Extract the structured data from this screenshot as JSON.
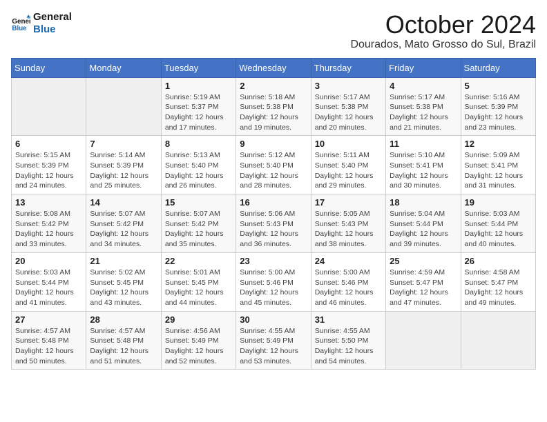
{
  "header": {
    "logo_general": "General",
    "logo_blue": "Blue",
    "month_title": "October 2024",
    "location": "Dourados, Mato Grosso do Sul, Brazil"
  },
  "calendar": {
    "days_of_week": [
      "Sunday",
      "Monday",
      "Tuesday",
      "Wednesday",
      "Thursday",
      "Friday",
      "Saturday"
    ],
    "weeks": [
      [
        {
          "day": "",
          "info": ""
        },
        {
          "day": "",
          "info": ""
        },
        {
          "day": "1",
          "info": "Sunrise: 5:19 AM\nSunset: 5:37 PM\nDaylight: 12 hours and 17 minutes."
        },
        {
          "day": "2",
          "info": "Sunrise: 5:18 AM\nSunset: 5:38 PM\nDaylight: 12 hours and 19 minutes."
        },
        {
          "day": "3",
          "info": "Sunrise: 5:17 AM\nSunset: 5:38 PM\nDaylight: 12 hours and 20 minutes."
        },
        {
          "day": "4",
          "info": "Sunrise: 5:17 AM\nSunset: 5:38 PM\nDaylight: 12 hours and 21 minutes."
        },
        {
          "day": "5",
          "info": "Sunrise: 5:16 AM\nSunset: 5:39 PM\nDaylight: 12 hours and 23 minutes."
        }
      ],
      [
        {
          "day": "6",
          "info": "Sunrise: 5:15 AM\nSunset: 5:39 PM\nDaylight: 12 hours and 24 minutes."
        },
        {
          "day": "7",
          "info": "Sunrise: 5:14 AM\nSunset: 5:39 PM\nDaylight: 12 hours and 25 minutes."
        },
        {
          "day": "8",
          "info": "Sunrise: 5:13 AM\nSunset: 5:40 PM\nDaylight: 12 hours and 26 minutes."
        },
        {
          "day": "9",
          "info": "Sunrise: 5:12 AM\nSunset: 5:40 PM\nDaylight: 12 hours and 28 minutes."
        },
        {
          "day": "10",
          "info": "Sunrise: 5:11 AM\nSunset: 5:40 PM\nDaylight: 12 hours and 29 minutes."
        },
        {
          "day": "11",
          "info": "Sunrise: 5:10 AM\nSunset: 5:41 PM\nDaylight: 12 hours and 30 minutes."
        },
        {
          "day": "12",
          "info": "Sunrise: 5:09 AM\nSunset: 5:41 PM\nDaylight: 12 hours and 31 minutes."
        }
      ],
      [
        {
          "day": "13",
          "info": "Sunrise: 5:08 AM\nSunset: 5:42 PM\nDaylight: 12 hours and 33 minutes."
        },
        {
          "day": "14",
          "info": "Sunrise: 5:07 AM\nSunset: 5:42 PM\nDaylight: 12 hours and 34 minutes."
        },
        {
          "day": "15",
          "info": "Sunrise: 5:07 AM\nSunset: 5:42 PM\nDaylight: 12 hours and 35 minutes."
        },
        {
          "day": "16",
          "info": "Sunrise: 5:06 AM\nSunset: 5:43 PM\nDaylight: 12 hours and 36 minutes."
        },
        {
          "day": "17",
          "info": "Sunrise: 5:05 AM\nSunset: 5:43 PM\nDaylight: 12 hours and 38 minutes."
        },
        {
          "day": "18",
          "info": "Sunrise: 5:04 AM\nSunset: 5:44 PM\nDaylight: 12 hours and 39 minutes."
        },
        {
          "day": "19",
          "info": "Sunrise: 5:03 AM\nSunset: 5:44 PM\nDaylight: 12 hours and 40 minutes."
        }
      ],
      [
        {
          "day": "20",
          "info": "Sunrise: 5:03 AM\nSunset: 5:44 PM\nDaylight: 12 hours and 41 minutes."
        },
        {
          "day": "21",
          "info": "Sunrise: 5:02 AM\nSunset: 5:45 PM\nDaylight: 12 hours and 43 minutes."
        },
        {
          "day": "22",
          "info": "Sunrise: 5:01 AM\nSunset: 5:45 PM\nDaylight: 12 hours and 44 minutes."
        },
        {
          "day": "23",
          "info": "Sunrise: 5:00 AM\nSunset: 5:46 PM\nDaylight: 12 hours and 45 minutes."
        },
        {
          "day": "24",
          "info": "Sunrise: 5:00 AM\nSunset: 5:46 PM\nDaylight: 12 hours and 46 minutes."
        },
        {
          "day": "25",
          "info": "Sunrise: 4:59 AM\nSunset: 5:47 PM\nDaylight: 12 hours and 47 minutes."
        },
        {
          "day": "26",
          "info": "Sunrise: 4:58 AM\nSunset: 5:47 PM\nDaylight: 12 hours and 49 minutes."
        }
      ],
      [
        {
          "day": "27",
          "info": "Sunrise: 4:57 AM\nSunset: 5:48 PM\nDaylight: 12 hours and 50 minutes."
        },
        {
          "day": "28",
          "info": "Sunrise: 4:57 AM\nSunset: 5:48 PM\nDaylight: 12 hours and 51 minutes."
        },
        {
          "day": "29",
          "info": "Sunrise: 4:56 AM\nSunset: 5:49 PM\nDaylight: 12 hours and 52 minutes."
        },
        {
          "day": "30",
          "info": "Sunrise: 4:55 AM\nSunset: 5:49 PM\nDaylight: 12 hours and 53 minutes."
        },
        {
          "day": "31",
          "info": "Sunrise: 4:55 AM\nSunset: 5:50 PM\nDaylight: 12 hours and 54 minutes."
        },
        {
          "day": "",
          "info": ""
        },
        {
          "day": "",
          "info": ""
        }
      ]
    ]
  }
}
